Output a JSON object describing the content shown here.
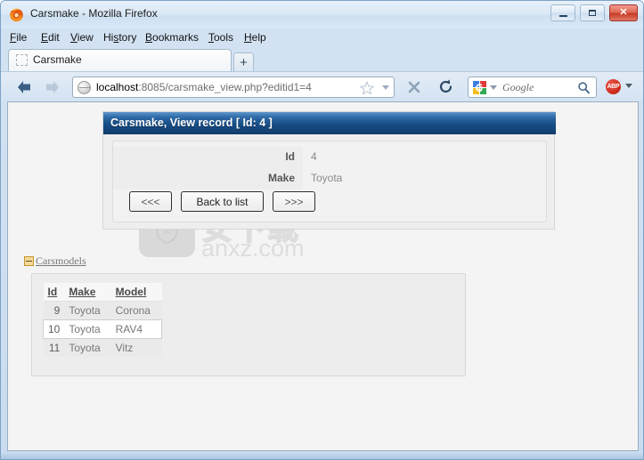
{
  "window": {
    "title": "Carsmake - Mozilla Firefox",
    "logo_icon": "firefox-icon",
    "minimize_label": "Minimize",
    "maximize_label": "Maximize",
    "close_label": "Close",
    "close_glyph": "✕"
  },
  "menubar": {
    "items": [
      {
        "label": "File",
        "accesskey": "F"
      },
      {
        "label": "Edit",
        "accesskey": "E"
      },
      {
        "label": "View",
        "accesskey": "V"
      },
      {
        "label": "History",
        "accesskey": "s"
      },
      {
        "label": "Bookmarks",
        "accesskey": "B"
      },
      {
        "label": "Tools",
        "accesskey": "T"
      },
      {
        "label": "Help",
        "accesskey": "H"
      }
    ]
  },
  "tabs": {
    "active_tab_label": "Carsmake",
    "favicon_icon": "placeholder-favicon-icon",
    "new_tab_label": "+",
    "new_tab_icon": "plus-icon"
  },
  "navbar": {
    "back_icon": "back-arrow-icon",
    "forward_icon": "forward-arrow-icon",
    "globe_icon": "globe-icon",
    "url_host": "localhost",
    "url_rest": ":8085/carsmake_view.php?editid1=4",
    "url_full": "localhost:8085/carsmake_view.php?editid1=4",
    "star_icon": "star-bookmark-icon",
    "url_dropdown_icon": "chevron-down-icon",
    "stop_icon": "stop-x-icon",
    "reload_icon": "reload-icon",
    "search_engine_icon": "google-icon",
    "search_engine_dropdown_icon": "chevron-down-icon",
    "search_placeholder": "Google",
    "search_value": "",
    "search_magnifier_icon": "magnifier-icon",
    "adblock_icon": "adblock-plus-icon",
    "adblock_label": "ABP",
    "adblock_dropdown_icon": "chevron-down-icon"
  },
  "page": {
    "record": {
      "header_title": "Carsmake, View record [ Id: 4 ]",
      "fields": [
        {
          "label": "Id",
          "value": "4"
        },
        {
          "label": "Make",
          "value": "Toyota"
        }
      ],
      "buttons": {
        "prev": "<<<",
        "back_to_list": "Back to list",
        "next": ">>>"
      }
    },
    "related": {
      "link_label": "Carsmodels",
      "expand_icon": "collapse-minus-icon",
      "table": {
        "columns": [
          "Id",
          "Make",
          "Model"
        ],
        "rows": [
          {
            "id": "9",
            "make": "Toyota",
            "model": "Corona",
            "highlighted": false
          },
          {
            "id": "10",
            "make": "Toyota",
            "model": "RAV4",
            "highlighted": true
          },
          {
            "id": "11",
            "make": "Toyota",
            "model": "Vitz",
            "highlighted": false
          }
        ]
      }
    },
    "watermark": {
      "cjk_text": "安下载",
      "url_text": "anxz.com",
      "shield_icon": "shield-logo-icon",
      "shield_char": "安"
    }
  },
  "colors": {
    "header_blue_top": "#5e96cb",
    "header_blue_bottom": "#123c6b",
    "panel_gray": "#eeeeee",
    "highlight_row": "#ffffff",
    "link_gray": "#7a7a7a",
    "close_red": "#c83c28"
  }
}
